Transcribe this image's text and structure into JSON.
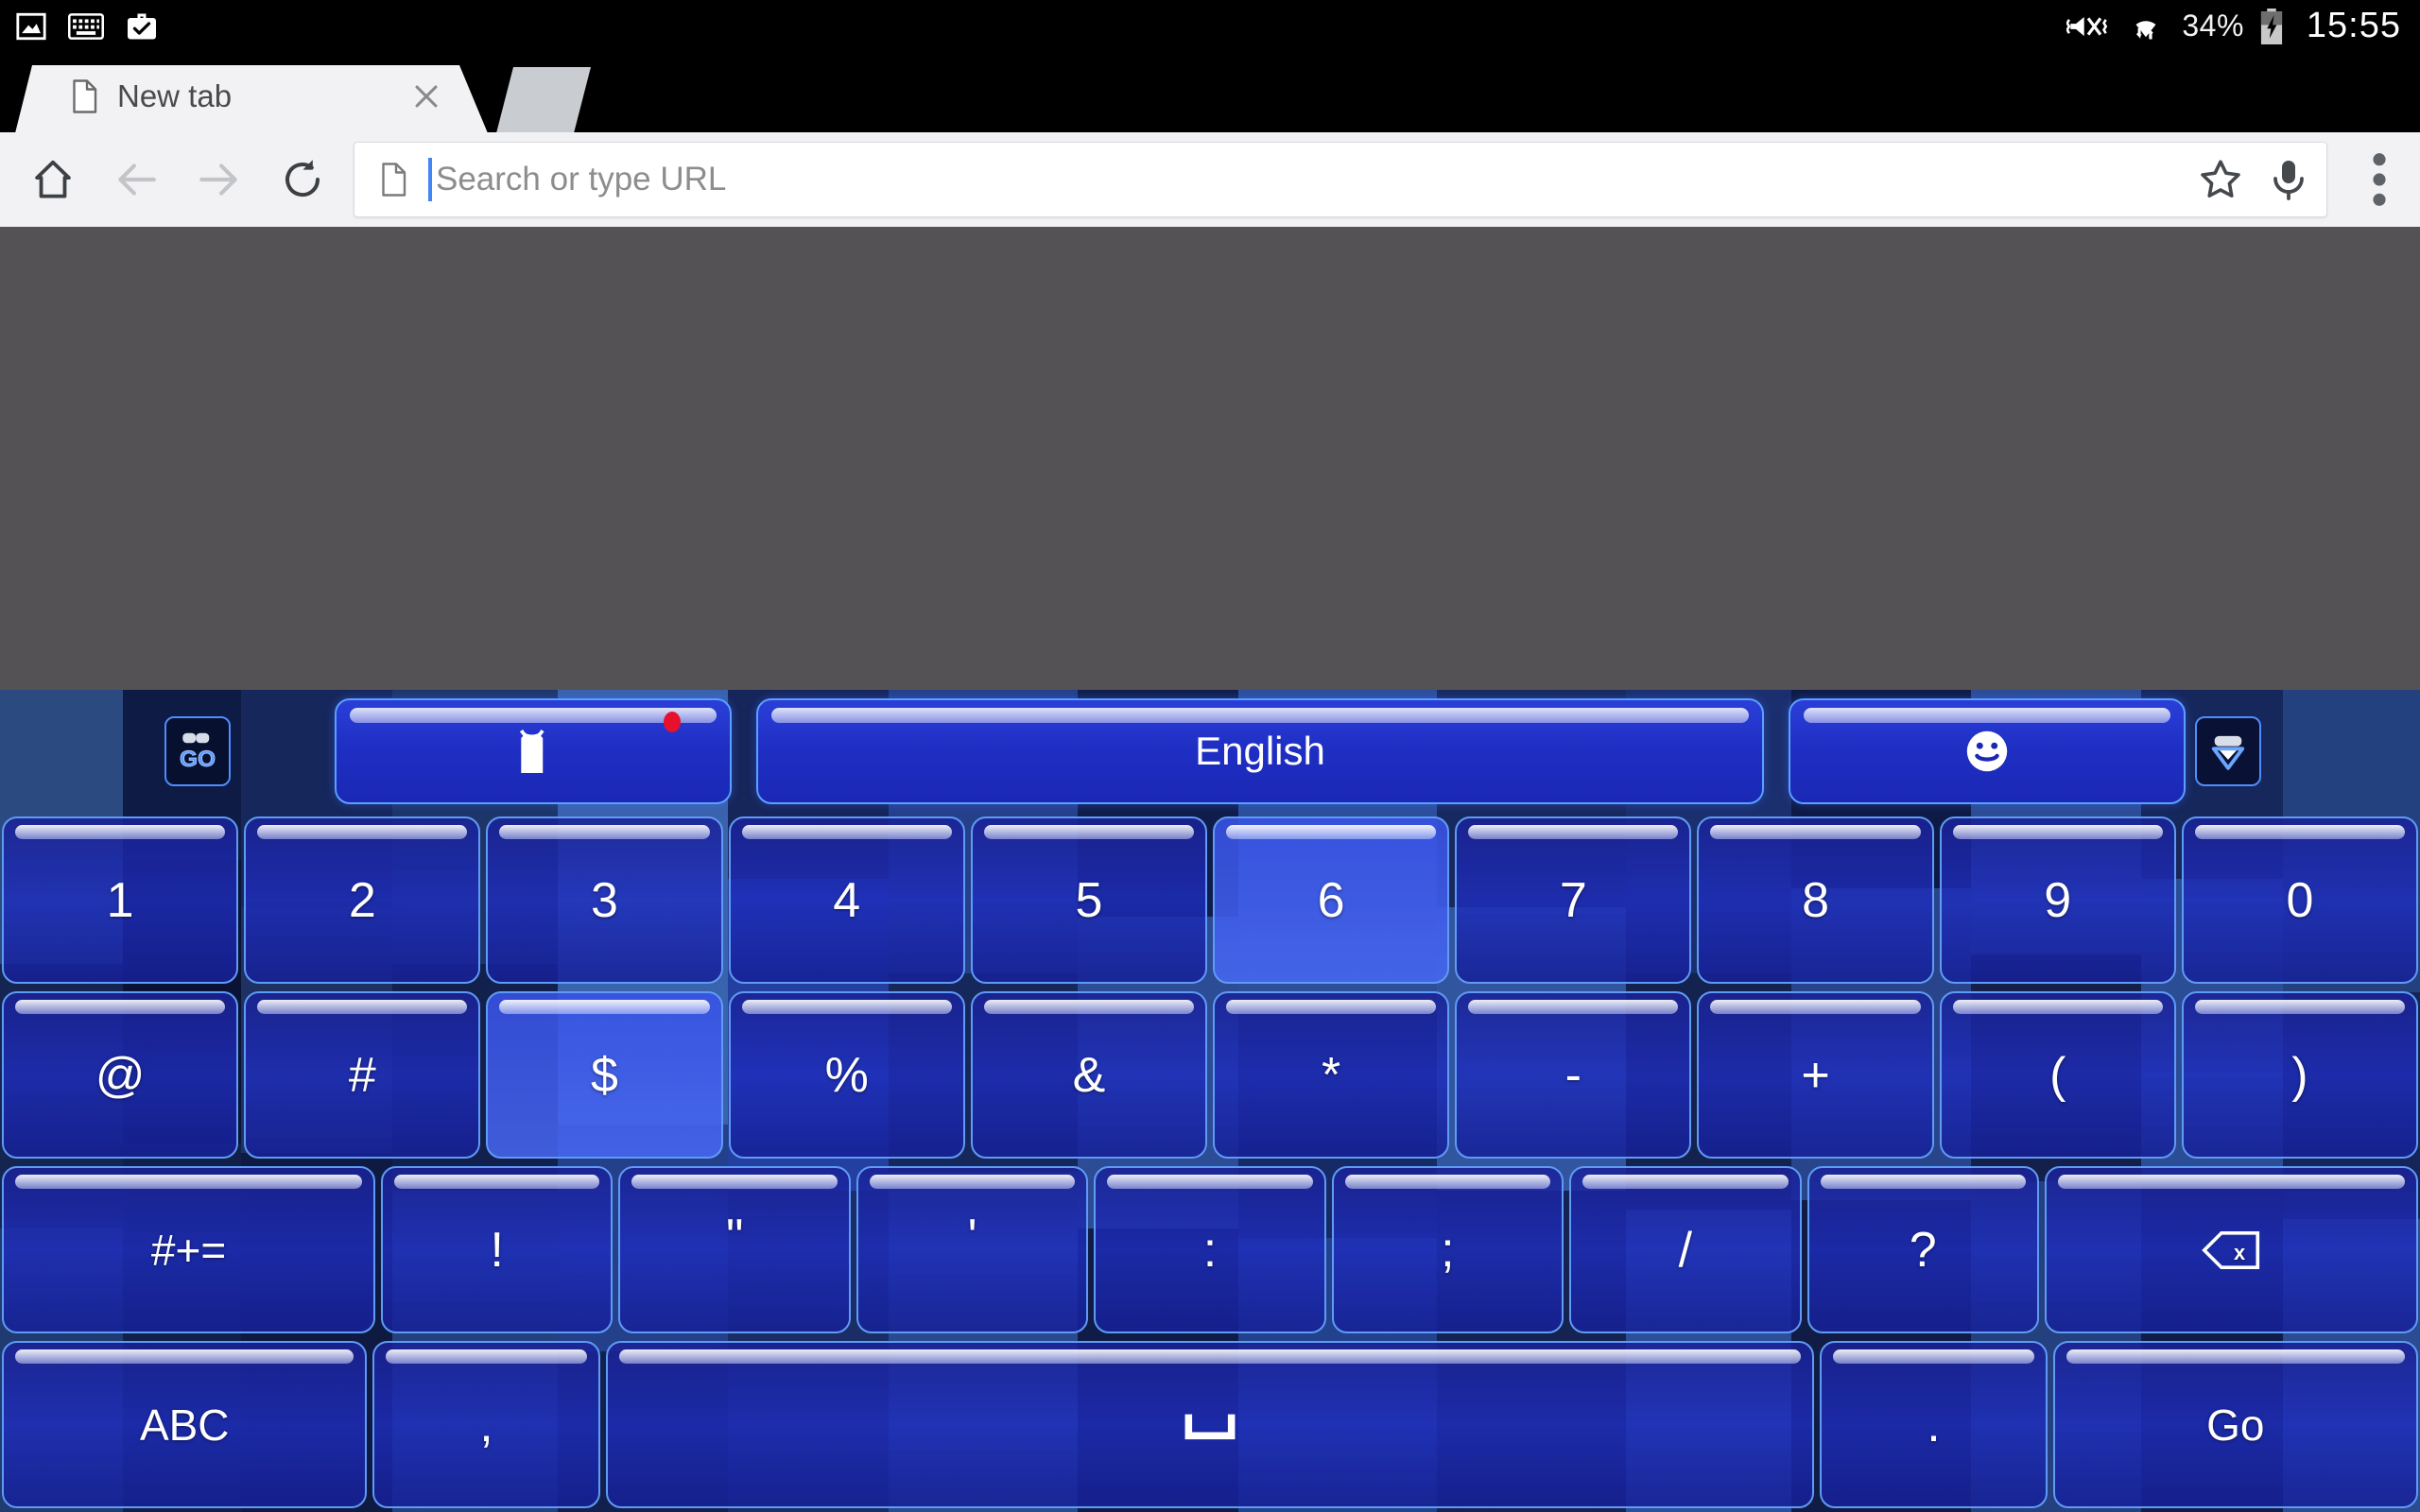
{
  "status_bar": {
    "left_icons": [
      "image-icon",
      "keyboard-icon",
      "work-briefcase-check-icon"
    ],
    "right": {
      "vibrate_icon": "volume-mute-vibrate-icon",
      "wifi_icon": "wifi-transfer-icon",
      "battery_percent": "34%",
      "battery_icon": "battery-charging-icon",
      "clock": "15:55"
    }
  },
  "browser": {
    "tab": {
      "title": "New tab",
      "favicon": "page-icon",
      "close": "close-icon"
    },
    "toolbar": {
      "home": "home-icon",
      "back": "back-arrow-icon",
      "forward": "forward-arrow-icon",
      "reload": "reload-icon",
      "menu": "more-vertical-icon"
    },
    "omnibox": {
      "page_icon": "page-icon",
      "placeholder": "Search or type URL",
      "value": "",
      "bookmark": "star-icon",
      "voice": "microphone-icon"
    }
  },
  "keyboard": {
    "theme_name": "GO Keyboard blue mosaic",
    "accent_color": "#2a3fd8",
    "border_color": "#5f9bf5",
    "top_bar": {
      "logo_label": "GO",
      "theme_button_icon": "t-shirt-icon",
      "theme_badge": "new-dot",
      "language_label": "English",
      "emoji_button_icon": "smiley-icon",
      "hide_keyboard_icon": "hide-keyboard-icon"
    },
    "layout": "symbols",
    "rows": [
      [
        {
          "label": "1",
          "name": "key-1"
        },
        {
          "label": "2",
          "name": "key-2"
        },
        {
          "label": "3",
          "name": "key-3"
        },
        {
          "label": "4",
          "name": "key-4"
        },
        {
          "label": "5",
          "name": "key-5"
        },
        {
          "label": "6",
          "name": "key-6",
          "lit": true
        },
        {
          "label": "7",
          "name": "key-7"
        },
        {
          "label": "8",
          "name": "key-8"
        },
        {
          "label": "9",
          "name": "key-9"
        },
        {
          "label": "0",
          "name": "key-0"
        }
      ],
      [
        {
          "label": "@",
          "name": "key-at"
        },
        {
          "label": "#",
          "name": "key-hash"
        },
        {
          "label": "$",
          "name": "key-dollar",
          "lit": true
        },
        {
          "label": "%",
          "name": "key-percent"
        },
        {
          "label": "&",
          "name": "key-ampersand"
        },
        {
          "label": "*",
          "name": "key-asterisk"
        },
        {
          "label": "-",
          "name": "key-minus"
        },
        {
          "label": "+",
          "name": "key-plus"
        },
        {
          "label": "(",
          "name": "key-paren-open"
        },
        {
          "label": ")",
          "name": "key-paren-close"
        }
      ],
      [
        {
          "label": "#+=",
          "name": "key-more-symbols",
          "flex": "1-6",
          "size": "word"
        },
        {
          "label": "!",
          "name": "key-exclamation"
        },
        {
          "label": "\"",
          "name": "key-double-quote",
          "raised": true
        },
        {
          "label": "'",
          "name": "key-apostrophe",
          "raised": true
        },
        {
          "label": ":",
          "name": "key-colon"
        },
        {
          "label": ";",
          "name": "key-semicolon"
        },
        {
          "label": "/",
          "name": "key-slash"
        },
        {
          "label": "?",
          "name": "key-question"
        },
        {
          "label": "",
          "name": "key-backspace",
          "icon": "backspace-icon",
          "flex": "1-6"
        }
      ],
      [
        {
          "label": "ABC",
          "name": "key-abc-layout",
          "flex": "1-6",
          "size": "word"
        },
        {
          "label": ",",
          "name": "key-comma"
        },
        {
          "label": "",
          "name": "key-space",
          "icon": "space-icon",
          "flex": "5-5"
        },
        {
          "label": ".",
          "name": "key-period"
        },
        {
          "label": "Go",
          "name": "key-go-enter",
          "flex": "1-6",
          "size": "word"
        }
      ]
    ]
  }
}
